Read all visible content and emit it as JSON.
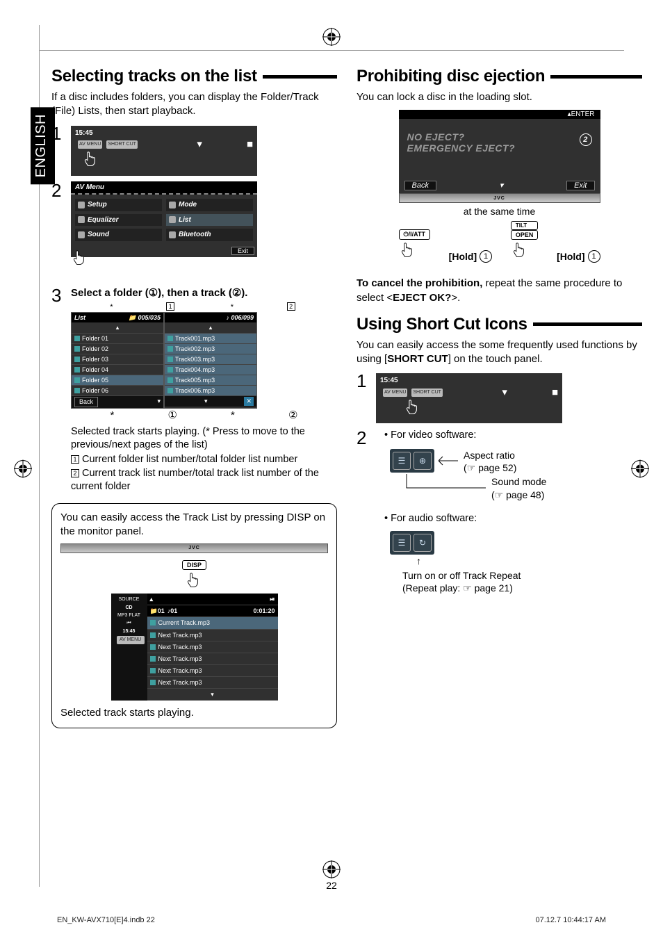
{
  "lang_tab": "ENGLISH",
  "page_number": "22",
  "footer_left": "EN_KW-AVX710[E]4.indb   22",
  "footer_right": "07.12.7   10:44:17 AM",
  "left": {
    "h2": "Selecting tracks on the list",
    "intro": "If a disc includes folders, you can display the Folder/Track (File) Lists, then start playback.",
    "step1_time": "15:45",
    "step1_av": "AV MENU",
    "step1_sc": "SHORT CUT",
    "avmenu_title": "AV Menu",
    "avmenu_items": [
      "Setup",
      "Mode",
      "Equalizer",
      "List",
      "Sound",
      "Bluetooth"
    ],
    "avmenu_exit": "Exit",
    "step3_text": "Select a folder (①), then a track (②).",
    "list_title": "List",
    "list_counters_folder": "005/035",
    "list_counters_track": "006/099",
    "folders": [
      "Folder 01",
      "Folder 02",
      "Folder 03",
      "Folder 04",
      "Folder 05",
      "Folder 06"
    ],
    "folder_back": "Back",
    "tracks": [
      "Track001.mp3",
      "Track002.mp3",
      "Track003.mp3",
      "Track004.mp3",
      "Track005.mp3",
      "Track006.mp3"
    ],
    "after_list_1": "Selected track starts playing. (* Press to move to the previous/next pages of the list)",
    "leg1": "Current folder list number/total folder list number",
    "leg2": "Current track list number/total track list number of the current folder",
    "note_text": "You can easily access the Track List by pressing DISP on the monitor panel.",
    "device_logo": "JVC",
    "disp_btn": "DISP",
    "tl_source": "SOURCE",
    "tl_cd": "CD",
    "tl_mp3": "MP3 FLAT",
    "tl_time": "15:45",
    "tl_top_left": "01",
    "tl_top_mid": "01",
    "tl_top_right": "0:01:20",
    "tl_tracks": [
      "Current Track.mp3",
      "Next Track.mp3",
      "Next Track.mp3",
      "Next Track.mp3",
      "Next Track.mp3",
      "Next Track.mp3"
    ],
    "note_result": "Selected track starts playing."
  },
  "right": {
    "h2a": "Prohibiting disc ejection",
    "intro_a": "You can lock a disc in the loading slot.",
    "ej_enter": "ENTER",
    "ej_line1": "NO EJECT?",
    "ej_line2": "EMERGENCY EJECT?",
    "ej_back": "Back",
    "ej_exit": "Exit",
    "ej_mid": "at the same time",
    "hold": "[Hold]",
    "btn_att": "⏻/I/ATT",
    "btn_tilt": "TILT",
    "btn_open": "OPEN",
    "cancel_bold": "To cancel the prohibition,",
    "cancel_rest": " repeat the same procedure to select <",
    "cancel_code": "EJECT OK?",
    "cancel_tail": ">.",
    "h2b": "Using Short Cut Icons",
    "intro_b1": "You can easily access the some frequently used functions by using [",
    "intro_b_bold": "SHORT CUT",
    "intro_b2": "] on the touch panel.",
    "step2_video": "For video software:",
    "aspect": "Aspect ratio",
    "aspect_ref": "(☞ page 52)",
    "sound": "Sound mode",
    "sound_ref": "(☞ page 48)",
    "step2_audio": "For audio software:",
    "repeat1": "Turn on or off Track Repeat",
    "repeat2": "(Repeat play: ☞ page 21)"
  }
}
